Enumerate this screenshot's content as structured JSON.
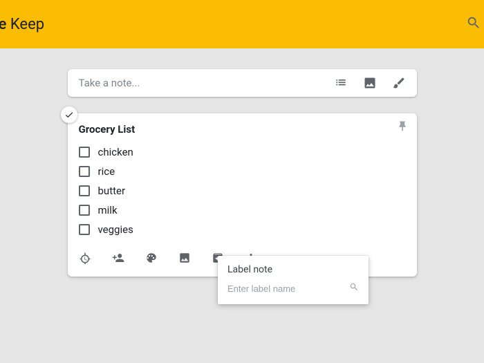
{
  "header": {
    "app_name_partial": "le",
    "product_name": "Keep"
  },
  "compose": {
    "placeholder": "Take a note..."
  },
  "note": {
    "title": "Grocery List",
    "items": [
      "chicken",
      "rice",
      "butter",
      "milk",
      "veggies"
    ]
  },
  "label_popup": {
    "title": "Label note",
    "placeholder": "Enter label name"
  }
}
